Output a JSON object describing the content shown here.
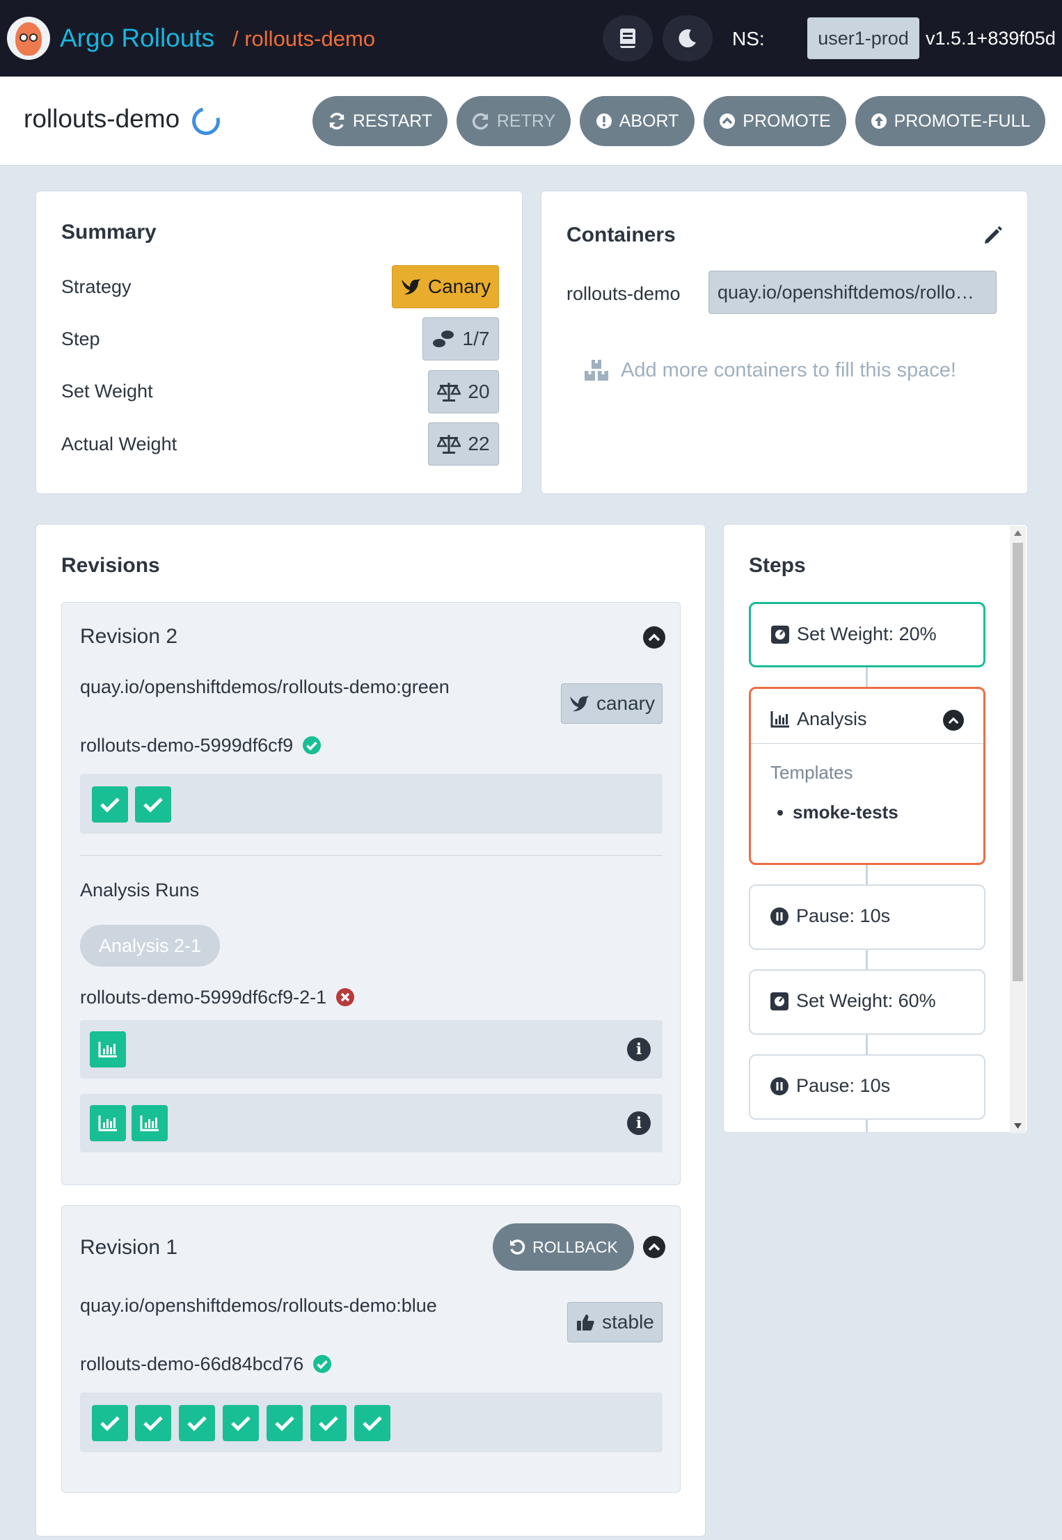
{
  "header": {
    "app_title": "Argo Rollouts",
    "breadcrumb": "/ rollouts-demo",
    "ns_label": "NS:",
    "namespace": "user1-prod",
    "version": "v1.5.1+839f05d"
  },
  "rollout": {
    "name": "rollouts-demo",
    "actions": {
      "restart": "RESTART",
      "retry": "RETRY",
      "abort": "ABORT",
      "promote": "PROMOTE",
      "promote_full": "PROMOTE-FULL"
    }
  },
  "summary": {
    "title": "Summary",
    "rows": [
      {
        "label": "Strategy",
        "value": "Canary",
        "icon": "bird-icon"
      },
      {
        "label": "Step",
        "value": "1/7",
        "icon": "footsteps-icon"
      },
      {
        "label": "Set Weight",
        "value": "20",
        "icon": "balance-icon"
      },
      {
        "label": "Actual Weight",
        "value": "22",
        "icon": "balance-icon"
      }
    ]
  },
  "containers": {
    "title": "Containers",
    "items": [
      {
        "name": "rollouts-demo",
        "image": "quay.io/openshiftdemos/rollo…"
      }
    ],
    "add_more": "Add more containers to fill this space!"
  },
  "revisions": {
    "title": "Revisions",
    "items": [
      {
        "title": "Revision 2",
        "image": "quay.io/openshiftdemos/rollouts-demo:green",
        "badge": "canary",
        "replicaset": "rollouts-demo-5999df6cf9",
        "pods": 2,
        "analysis_runs_label": "Analysis Runs",
        "analysis_button": "Analysis 2-1",
        "analysis_run": "rollouts-demo-5999df6cf9-2-1"
      },
      {
        "title": "Revision 1",
        "rollback": "ROLLBACK",
        "image": "quay.io/openshiftdemos/rollouts-demo:blue",
        "badge": "stable",
        "replicaset": "rollouts-demo-66d84bcd76",
        "pods": 7
      }
    ]
  },
  "steps": {
    "title": "Steps",
    "items": [
      {
        "label": "Set Weight: 20%",
        "state": "complete"
      },
      {
        "label": "Analysis",
        "state": "current",
        "templates_label": "Templates",
        "templates": [
          "smoke-tests"
        ]
      },
      {
        "label": "Pause: 10s",
        "state": "pending"
      },
      {
        "label": "Set Weight: 60%",
        "state": "pending"
      },
      {
        "label": "Pause: 10s",
        "state": "pending"
      }
    ]
  },
  "colors": {
    "accent_blue": "#18b6e0",
    "accent_orange": "#f06d3b",
    "success_green": "#18be94",
    "canary_yellow": "#e8ad2c",
    "step_complete": "#19bc95",
    "step_current": "#ef6c44"
  }
}
